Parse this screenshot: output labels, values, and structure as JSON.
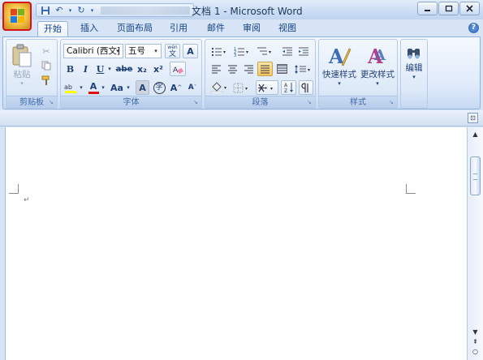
{
  "window": {
    "title": "文档 1 - Microsoft Word"
  },
  "tabs": [
    "开始",
    "插入",
    "页面布局",
    "引用",
    "邮件",
    "审阅",
    "视图"
  ],
  "active_tab": "开始",
  "clipboard": {
    "paste_label": "粘贴",
    "group_label": "剪贴板"
  },
  "font": {
    "family": "Calibri (西文]",
    "size": "五号",
    "group_label": "字体",
    "wen_label": "wén",
    "a_box_label": "A",
    "bold": "B",
    "italic": "I",
    "underline": "U",
    "strike": "abe",
    "sub": "x₂",
    "sup": "x²",
    "color_a": "A",
    "aa_label": "Aa",
    "shade_a": "A",
    "enclose": "字",
    "grow": "A",
    "shrink": "A"
  },
  "paragraph": {
    "group_label": "段落"
  },
  "styles": {
    "quick_label": "快速样式",
    "change_label": "更改样式",
    "group_label": "样式"
  },
  "editing": {
    "label": "编辑"
  },
  "colors": {
    "accent": "#15428b",
    "office_border": "#d4141a"
  }
}
